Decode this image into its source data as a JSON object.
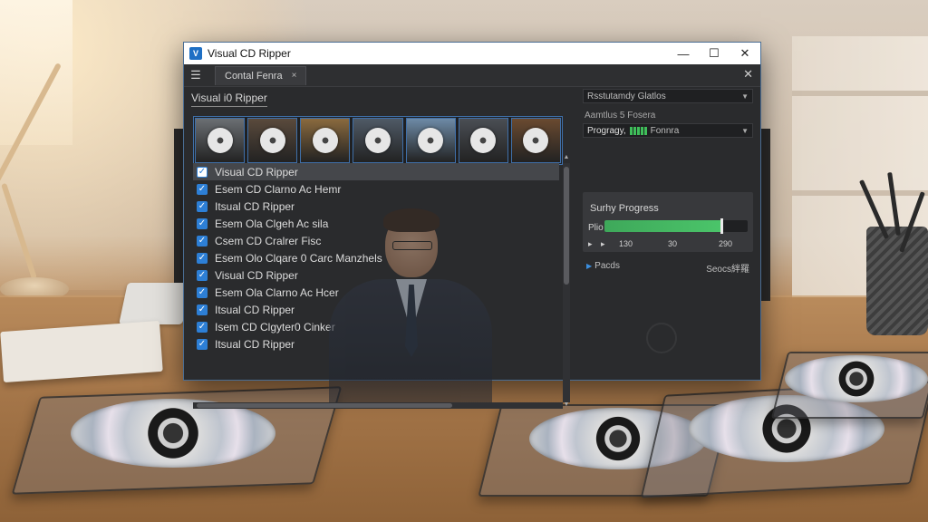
{
  "window": {
    "title": "Visual CD Ripper",
    "controls": {
      "minimize": "—",
      "maximize": "☐",
      "close": "✕"
    }
  },
  "tabbar": {
    "menu_icon": "☰",
    "tab_label": "Contal Fenra",
    "tab_close": "×",
    "close_all": "✕"
  },
  "left": {
    "title": "Visual i0 Ripper",
    "thumbnails": [
      {
        "bg": "#6b6f73"
      },
      {
        "bg": "#5a4a3c"
      },
      {
        "bg": "#8a6a3e"
      },
      {
        "bg": "#4f5a66"
      },
      {
        "bg": "#6d8aa6"
      },
      {
        "bg": "#4a4e54"
      },
      {
        "bg": "#6a4a30"
      }
    ],
    "tracks": [
      {
        "label": "Visual CD Ripper",
        "selected": true
      },
      {
        "label": "Esem CD Clarno Ac Hemr"
      },
      {
        "label": "Itsual CD Ripper"
      },
      {
        "label": "Esem Ola Clgeh Ac sila"
      },
      {
        "label": "Csem CD Cralrer Fisc"
      },
      {
        "label": "Esem Olo Clqare 0 Carc Manzhels"
      },
      {
        "label": "Visual CD Ripper"
      },
      {
        "label": "Esem Ola Clarno Ac Hcer"
      },
      {
        "label": "Itsual CD Ripper"
      },
      {
        "label": "Isem CD Clgyter0 Cinker"
      },
      {
        "label": "Itsual CD Ripper"
      }
    ]
  },
  "right": {
    "dropdown1": "Rsstutamdy Glatlos",
    "label1": "Aamtlus 5 Fosera",
    "dropdown2_label": "Progragy,",
    "dropdown2_suffix": "Fonnra",
    "progress": {
      "title": "Surhy Progress",
      "prefix": "Plio",
      "fraction": 0.82,
      "ticks": [
        "▸",
        "▸",
        "130",
        "30",
        "290"
      ]
    },
    "status_left": "Pacds",
    "status_right": "Seocs絆羅"
  }
}
